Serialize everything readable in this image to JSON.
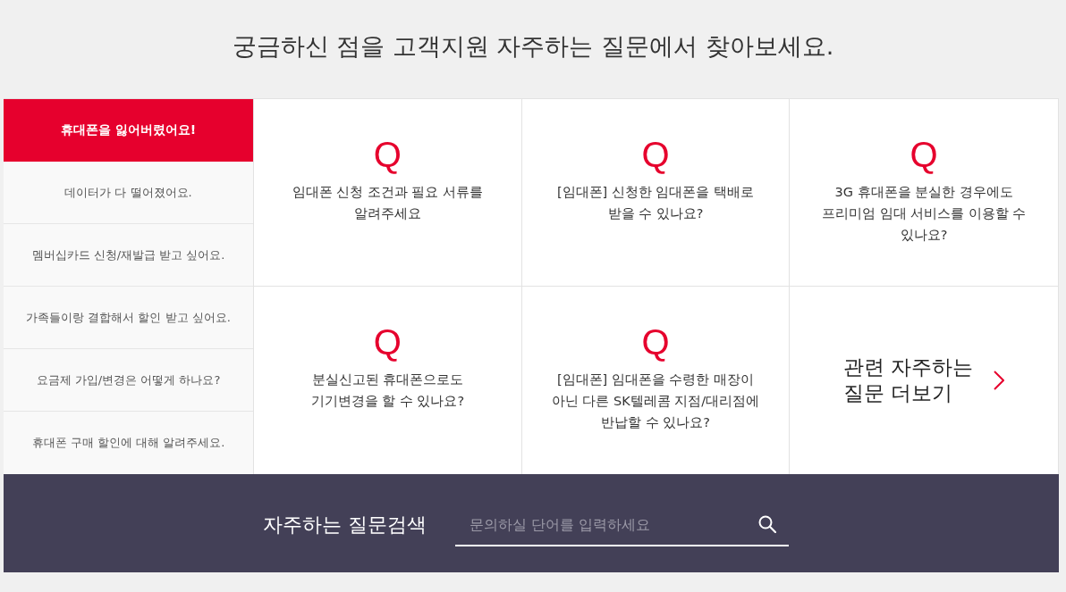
{
  "heading": "궁금하신 점을 고객지원 자주하는 질문에서 찾아보세요.",
  "categories": [
    {
      "label": "휴대폰을 잃어버렸어요!",
      "selected": true
    },
    {
      "label": "데이터가 다 떨어졌어요.",
      "selected": false
    },
    {
      "label": "멤버십카드 신청/재발급 받고 싶어요.",
      "selected": false
    },
    {
      "label": "가족들이랑 결합해서 할인 받고 싶어요.",
      "selected": false
    },
    {
      "label": "요금제 가입/변경은 어떻게 하나요?",
      "selected": false
    },
    {
      "label": "휴대폰 구매 할인에 대해 알려주세요.",
      "selected": false
    }
  ],
  "questions": [
    {
      "mark": "Q",
      "text": "임대폰 신청 조건과 필요 서류를 알려주세요"
    },
    {
      "mark": "Q",
      "text": "[임대폰] 신청한 임대폰을 택배로 받을 수 있나요?"
    },
    {
      "mark": "Q",
      "text": "3G 휴대폰을 분실한 경우에도 프리미엄 임대 서비스를 이용할 수 있나요?"
    },
    {
      "mark": "Q",
      "text": "분실신고된 휴대폰으로도 기기변경을 할 수 있나요?"
    },
    {
      "mark": "Q",
      "text": "[임대폰] 임대폰을 수령한 매장이 아닌 다른 SK텔레콤 지점/대리점에 반납할 수 있나요?"
    }
  ],
  "more_link": {
    "text": "관련 자주하는 질문 더보기"
  },
  "search": {
    "label": "자주하는 질문검색",
    "placeholder": "문의하실 단어를 입력하세요"
  }
}
